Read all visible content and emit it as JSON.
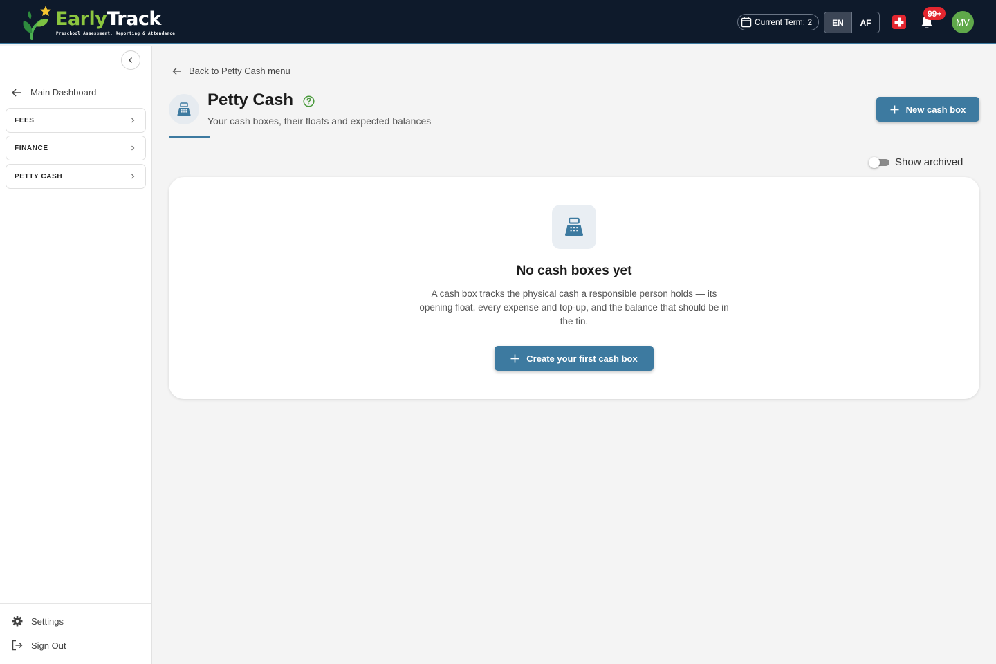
{
  "app": {
    "logo_primary": "Early",
    "logo_secondary": "Track",
    "logo_tagline": "Preschool Assessment, Reporting & Attendance"
  },
  "header": {
    "term_label": "Current Term: 2",
    "languages": [
      "EN",
      "AF"
    ],
    "active_language": "EN",
    "notification_count": "99+",
    "avatar_initials": "MV"
  },
  "sidebar": {
    "back_label": "Main Dashboard",
    "items": [
      {
        "label": "FEES"
      },
      {
        "label": "FINANCE"
      },
      {
        "label": "PETTY CASH"
      }
    ],
    "footer": {
      "settings_label": "Settings",
      "signout_label": "Sign Out"
    }
  },
  "main": {
    "back_link": "Back to Petty Cash menu",
    "title": "Petty Cash",
    "subtitle": "Your cash boxes, their floats and expected balances",
    "new_button": "New cash box",
    "show_archived_label": "Show archived",
    "show_archived": false,
    "empty": {
      "title": "No cash boxes yet",
      "description": "A cash box tracks the physical cash a responsible person holds — its opening float, every expense and top-up, and the balance that should be in the tin.",
      "button": "Create your first cash box"
    }
  },
  "colors": {
    "topbar": "#0e1a2b",
    "accent": "#3d7aa0",
    "brand_green": "#8cc63f",
    "alert_red": "#e3262f",
    "avatar_green": "#5fa84a"
  }
}
